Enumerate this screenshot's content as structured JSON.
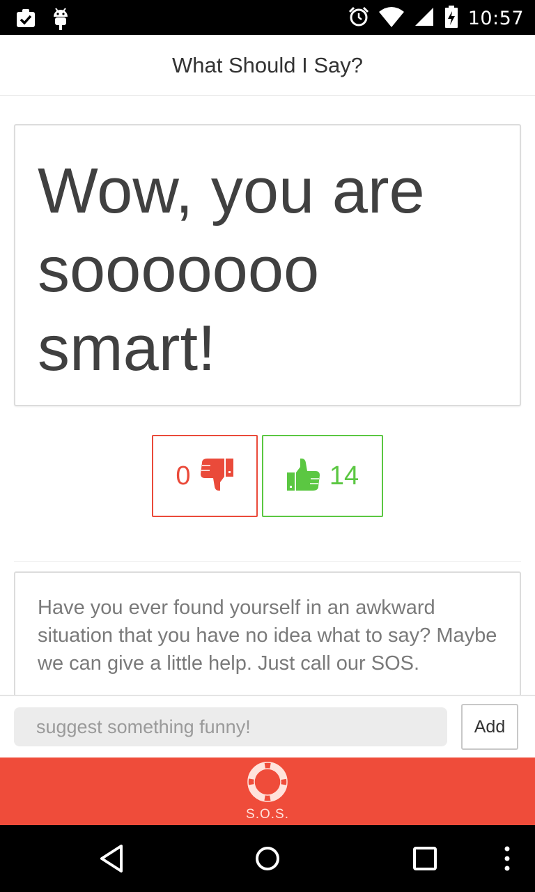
{
  "status_bar": {
    "time": "10:57",
    "left_icons": [
      "clipboard-check-icon",
      "android-debug-icon"
    ],
    "right_icons": [
      "alarm-icon",
      "wifi-icon",
      "cell-signal-icon",
      "battery-charging-icon"
    ]
  },
  "header": {
    "title": "What Should I Say?"
  },
  "quote": {
    "text": "Wow, you are sooooooo smart!"
  },
  "votes": {
    "down_count": "0",
    "up_count": "14",
    "down_icon": "thumbs-down-icon",
    "up_icon": "thumbs-up-icon",
    "down_color": "#ea4a3a",
    "up_color": "#5bc742"
  },
  "info": {
    "text": "Have you ever found yourself in an awkward situation that you have no idea what to say? Maybe we can give a little help. Just call our SOS."
  },
  "suggest": {
    "placeholder": "suggest something funny!",
    "value": "",
    "add_label": "Add"
  },
  "sos": {
    "label": "S.O.S.",
    "icon": "lifebuoy-icon",
    "color": "#ef4c3a"
  },
  "nav": {
    "icons": [
      "back-icon",
      "home-icon",
      "recents-icon",
      "overflow-menu-icon"
    ]
  }
}
